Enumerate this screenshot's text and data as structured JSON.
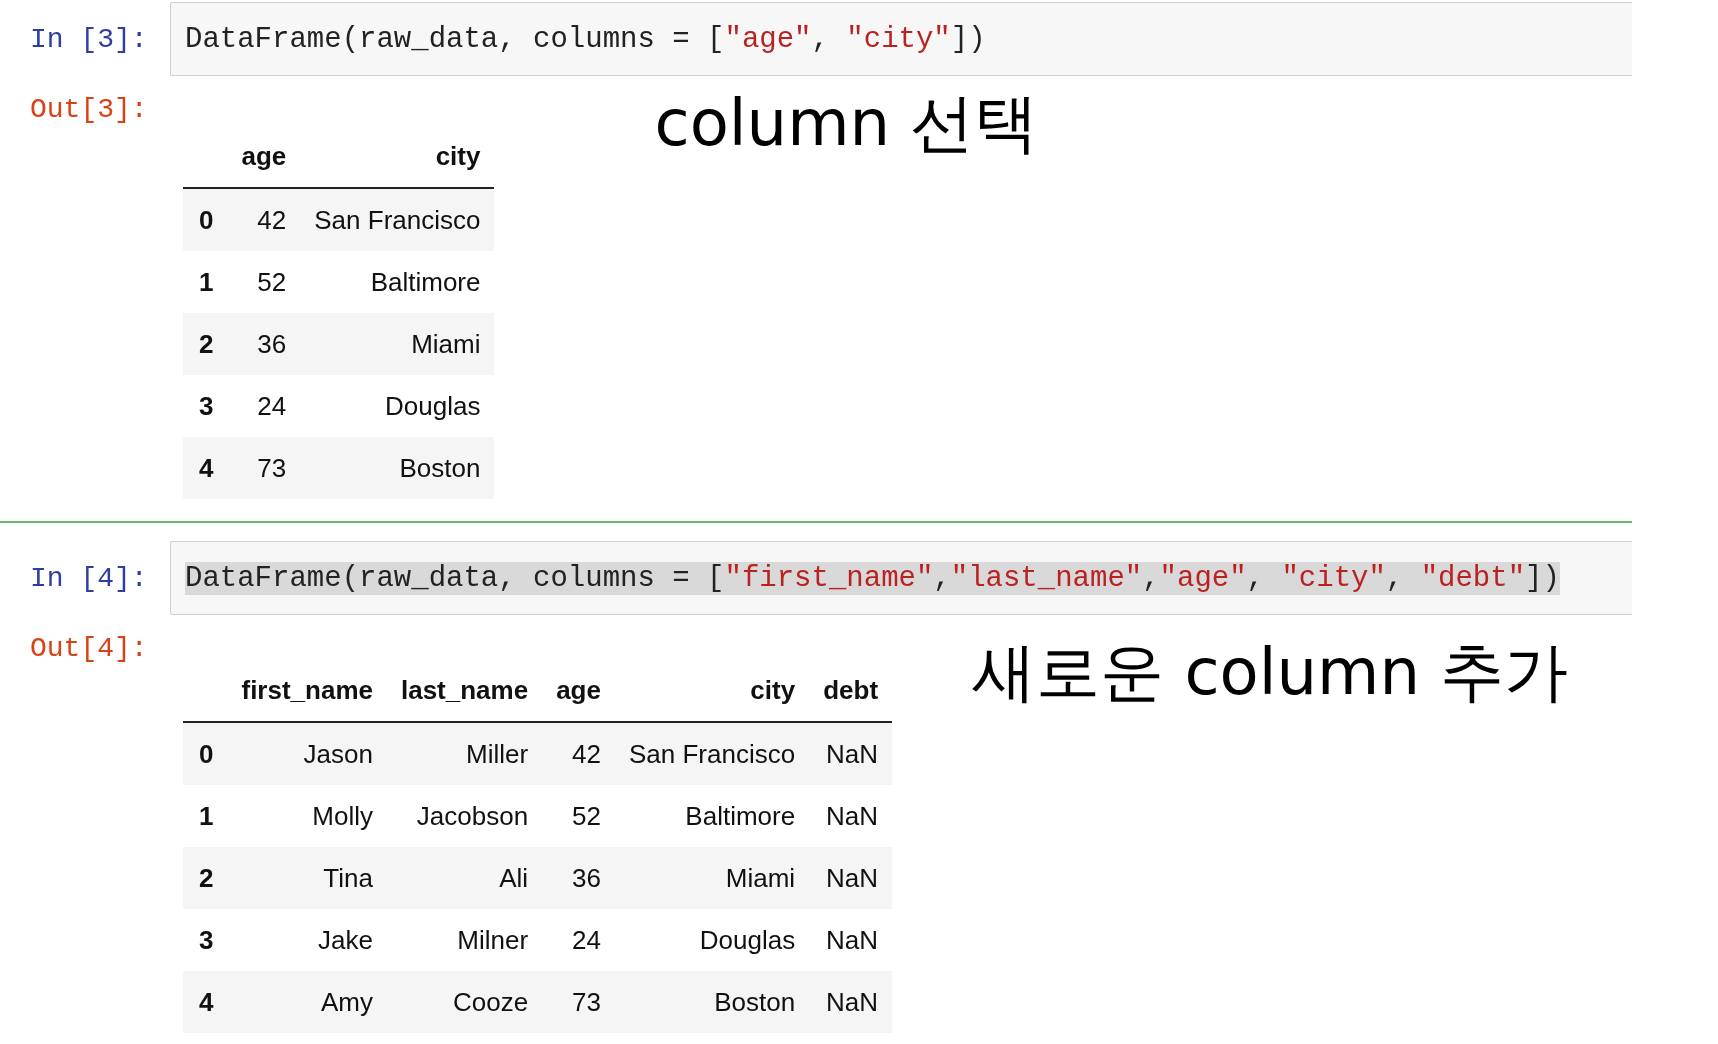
{
  "cells": [
    {
      "input_prompt": "In [3]:",
      "highlighted": false,
      "code": [
        {
          "kind": "plain",
          "text": "DataFrame(raw_data, columns = ["
        },
        {
          "kind": "string",
          "text": "\"age\""
        },
        {
          "kind": "plain",
          "text": ", "
        },
        {
          "kind": "string",
          "text": "\"city\""
        },
        {
          "kind": "plain",
          "text": "])"
        }
      ],
      "output_prompt": "Out[3]:",
      "table": {
        "columns": [
          "age",
          "city"
        ],
        "rows": [
          {
            "index": "0",
            "cells": [
              "42",
              "San Francisco"
            ]
          },
          {
            "index": "1",
            "cells": [
              "52",
              "Baltimore"
            ]
          },
          {
            "index": "2",
            "cells": [
              "36",
              "Miami"
            ]
          },
          {
            "index": "3",
            "cells": [
              "24",
              "Douglas"
            ]
          },
          {
            "index": "4",
            "cells": [
              "73",
              "Boston"
            ]
          }
        ]
      },
      "annotation": "column 선택"
    },
    {
      "input_prompt": "In [4]:",
      "highlighted": true,
      "code": [
        {
          "kind": "plain",
          "text": "DataFrame(raw_data, columns = ["
        },
        {
          "kind": "string",
          "text": "\"first_name\""
        },
        {
          "kind": "plain",
          "text": ","
        },
        {
          "kind": "string",
          "text": "\"last_name\""
        },
        {
          "kind": "plain",
          "text": ","
        },
        {
          "kind": "string",
          "text": "\"age\""
        },
        {
          "kind": "plain",
          "text": ", "
        },
        {
          "kind": "string",
          "text": "\"city\""
        },
        {
          "kind": "plain",
          "text": ", "
        },
        {
          "kind": "string",
          "text": "\"debt\""
        },
        {
          "kind": "plain",
          "text": "])"
        }
      ],
      "output_prompt": "Out[4]:",
      "table": {
        "columns": [
          "first_name",
          "last_name",
          "age",
          "city",
          "debt"
        ],
        "rows": [
          {
            "index": "0",
            "cells": [
              "Jason",
              "Miller",
              "42",
              "San Francisco",
              "NaN"
            ]
          },
          {
            "index": "1",
            "cells": [
              "Molly",
              "Jacobson",
              "52",
              "Baltimore",
              "NaN"
            ]
          },
          {
            "index": "2",
            "cells": [
              "Tina",
              "Ali",
              "36",
              "Miami",
              "NaN"
            ]
          },
          {
            "index": "3",
            "cells": [
              "Jake",
              "Milner",
              "24",
              "Douglas",
              "NaN"
            ]
          },
          {
            "index": "4",
            "cells": [
              "Amy",
              "Cooze",
              "73",
              "Boston",
              "NaN"
            ]
          }
        ]
      },
      "annotation": "새로운 column 추가"
    }
  ]
}
